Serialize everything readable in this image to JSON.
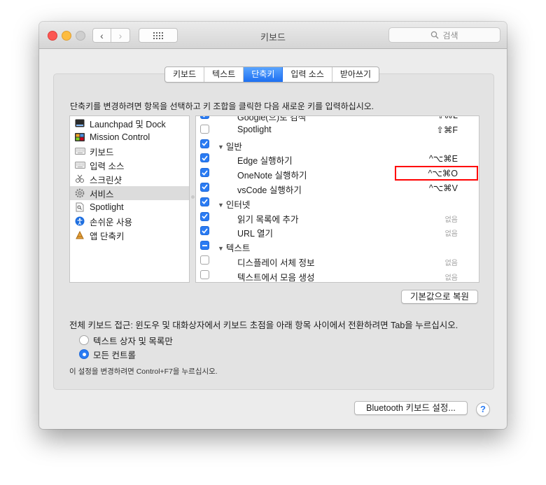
{
  "window": {
    "title": "키보드"
  },
  "search": {
    "placeholder": "검색"
  },
  "tabs": [
    {
      "label": "키보드"
    },
    {
      "label": "텍스트"
    },
    {
      "label": "단축키",
      "active": true
    },
    {
      "label": "입력 소스"
    },
    {
      "label": "받아쓰기"
    }
  ],
  "instruction": "단축키를 변경하려면 항목을 선택하고 키 조합을 클릭한 다음 새로운 키를 입력하십시오.",
  "categories": [
    {
      "label": "Launchpad 및 Dock",
      "icon": "launchpad-dock-icon"
    },
    {
      "label": "Mission Control",
      "icon": "mission-control-icon"
    },
    {
      "label": "키보드",
      "icon": "keyboard-icon"
    },
    {
      "label": "입력 소스",
      "icon": "input-sources-icon"
    },
    {
      "label": "스크린샷",
      "icon": "screenshot-icon"
    },
    {
      "label": "서비스",
      "icon": "services-gear-icon",
      "selected": true
    },
    {
      "label": "Spotlight",
      "icon": "spotlight-icon"
    },
    {
      "label": "손쉬운 사용",
      "icon": "accessibility-icon"
    },
    {
      "label": "앱 단축키",
      "icon": "app-shortcuts-icon"
    }
  ],
  "shortcuts": [
    {
      "kind": "item",
      "label": "Google(으)로 검색",
      "checked": true,
      "key": "⇧⌘L"
    },
    {
      "kind": "item",
      "label": "Spotlight",
      "checked": false,
      "key": "⇧⌘F"
    },
    {
      "kind": "category",
      "label": "일반",
      "checked": true
    },
    {
      "kind": "item",
      "label": "Edge 실행하기",
      "checked": true,
      "key": "^⌥⌘E"
    },
    {
      "kind": "item",
      "label": "OneNote 실행하기",
      "checked": true,
      "key": "^⌥⌘O"
    },
    {
      "kind": "item",
      "label": "vsCode 실행하기",
      "checked": true,
      "key": "^⌥⌘V"
    },
    {
      "kind": "category",
      "label": "인터넷",
      "checked": true
    },
    {
      "kind": "item",
      "label": "읽기 목록에 추가",
      "checked": true,
      "key": "없음"
    },
    {
      "kind": "item",
      "label": "URL 열기",
      "checked": true,
      "key": "없음"
    },
    {
      "kind": "category",
      "label": "텍스트",
      "checked": "mixed"
    },
    {
      "kind": "item",
      "label": "디스플레이 서체 정보",
      "checked": false,
      "key": "없음"
    },
    {
      "kind": "item",
      "label": "텍스트에서 모음 생성",
      "checked": false,
      "key": "없음"
    }
  ],
  "restore_button": "기본값으로 복원",
  "full_keyboard_access": {
    "label": "전체 키보드 접근: 윈도우 및 대화상자에서 키보드 초점을 아래 항목 사이에서 전환하려면 Tab을 누르십시오.",
    "options": [
      {
        "label": "텍스트 상자 및 목록만",
        "selected": false
      },
      {
        "label": "모든 컨트롤",
        "selected": true
      }
    ],
    "note": "이 설정을 변경하려면 Control+F7을 누르십시오."
  },
  "bluetooth_button": "Bluetooth 키보드 설정...",
  "help_button": "?",
  "colors": {
    "accent": "#2a7bf3",
    "highlight_box": "#ff0000"
  }
}
